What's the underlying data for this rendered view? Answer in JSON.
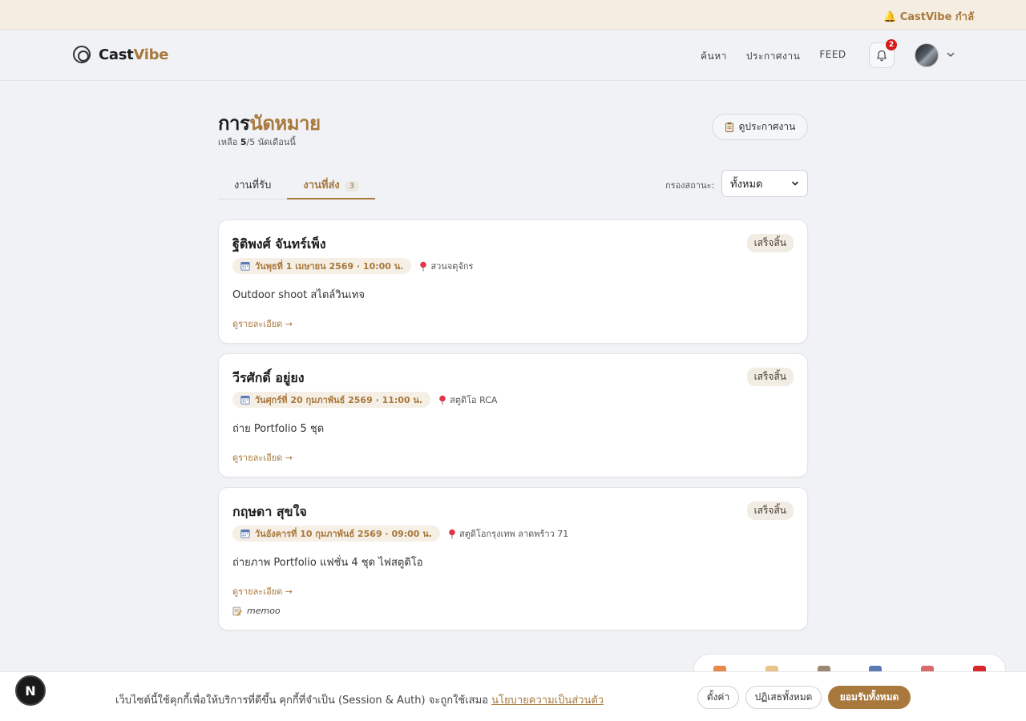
{
  "colors": {
    "accent": "#a8783c",
    "badge_red": "#d31c1c"
  },
  "topbar": {
    "ticker": "🔔 CastVibe กำลังอ"
  },
  "navbar": {
    "logo": {
      "text_main": "Cast",
      "text_accent": "Vibe"
    },
    "links": [
      "ค้นหา",
      "ประกาศงาน",
      "FEED"
    ],
    "notification_count": "2"
  },
  "page": {
    "title_main": "การ",
    "title_accent": "นัดหมาย",
    "subtitle_prefix": "เหลือ ",
    "subtitle_count": "5",
    "subtitle_suffix": "/5 นัดเดือนนี้",
    "view_button": "ดูประกาศงาน"
  },
  "tabs": [
    {
      "label": "งานที่รับ",
      "count": ""
    },
    {
      "label": "งานที่ส่ง",
      "count": "3"
    }
  ],
  "filter": {
    "label": "กรองสถานะ:",
    "value": "ทั้งหมด"
  },
  "appointments": [
    {
      "name": "ฐิติพงศ์ จันทร์เพ็ง",
      "status": "เสร็จสิ้น",
      "date": "วันพุธที่ 1 เมษายน 2569 · 10:00 น.",
      "location": "สวนจตุจักร",
      "description": "Outdoor shoot สไตล์วินเทจ",
      "link": "ดูรายละเอียด →",
      "note": ""
    },
    {
      "name": "วีรศักดิ์ อยู่ยง",
      "status": "เสร็จสิ้น",
      "date": "วันศุกร์ที่ 20 กุมภาพันธ์ 2569 · 11:00 น.",
      "location": "สตูดิโอ RCA",
      "description": "ถ่าย Portfolio 5 ชุด",
      "link": "ดูรายละเอียด →",
      "note": ""
    },
    {
      "name": "กฤษดา สุขใจ",
      "status": "เสร็จสิ้น",
      "date": "วันอังคารที่ 10 กุมภาพันธ์ 2569 · 09:00 น.",
      "location": "สตูดิโอกรุงเทพ ลาดพร้าว 71",
      "description": "ถ่ายภาพ Portfolio แฟชั่น 4 ชุด ไฟสตูดิโอ",
      "link": "ดูรายละเอียด →",
      "note": "memoo"
    }
  ],
  "cookie": {
    "text": "เว็บไซต์นี้ใช้คุกกี้เพื่อให้บริการที่ดีขึ้น คุกกี้ที่จำเป็น (Session & Auth) จะถูกใช้เสมอ ",
    "link": "นโยบายความเป็นส่วนตัว",
    "settings": "ตั้งค่า",
    "reject": "ปฏิเสธทั้งหมด",
    "accept": "ยอมรับทั้งหมด"
  },
  "next_badge": "N"
}
